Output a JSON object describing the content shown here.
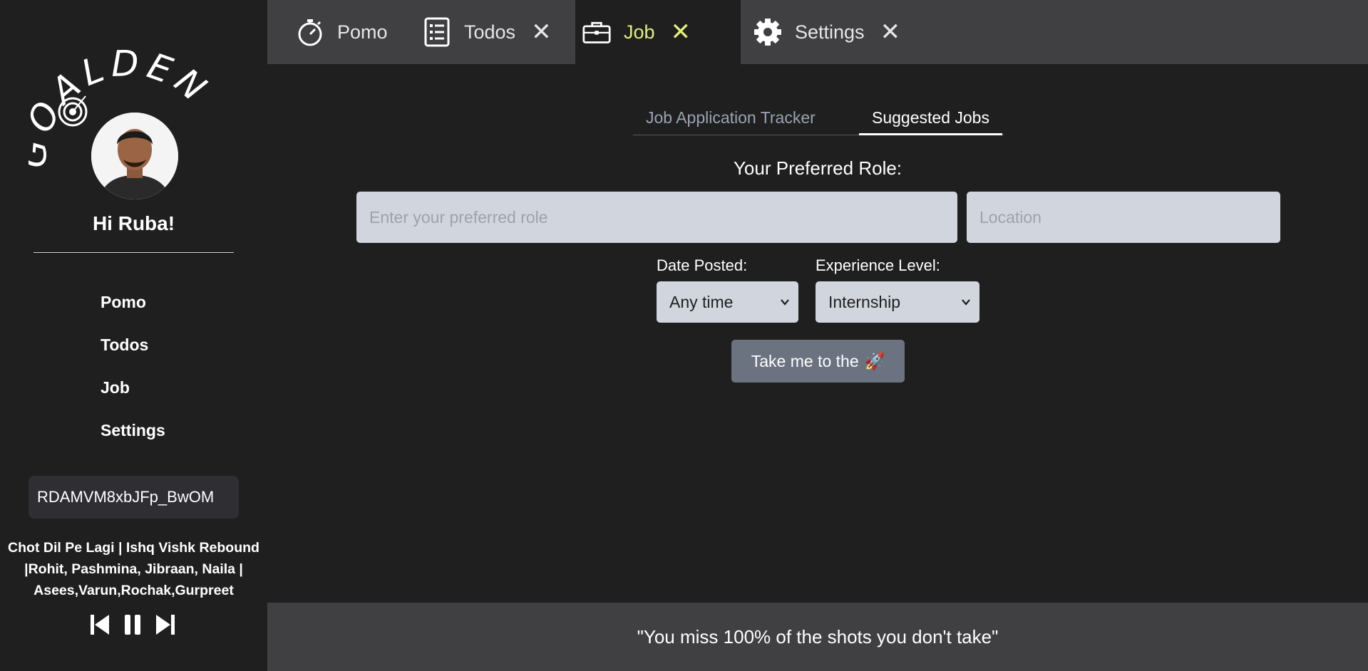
{
  "sidebar": {
    "logo_text": "GOALDEN",
    "greeting": "Hi Ruba!",
    "nav": [
      {
        "label": "Pomo"
      },
      {
        "label": "Todos"
      },
      {
        "label": "Job"
      },
      {
        "label": "Settings"
      }
    ],
    "video_id": "RDAMVM8xbJFp_BwOM",
    "song_title": "Chot Dil Pe Lagi | Ishq Vishk Rebound |Rohit, Pashmina, Jibraan, Naila | Asees,Varun,Rochak,Gurpreet"
  },
  "tabs": [
    {
      "label": "Pomo",
      "icon": "stopwatch-icon",
      "closable": false,
      "active": false
    },
    {
      "label": "Todos",
      "icon": "checklist-icon",
      "closable": true,
      "active": false
    },
    {
      "label": "Job",
      "icon": "briefcase-icon",
      "closable": true,
      "active": true
    },
    {
      "label": "Settings",
      "icon": "gear-icon",
      "closable": true,
      "active": false
    }
  ],
  "close_glyph": "✕",
  "main": {
    "subtabs": [
      {
        "label": "Job Application Tracker",
        "active": false
      },
      {
        "label": "Suggested Jobs",
        "active": true
      }
    ],
    "preferred_role_label": "Your Preferred Role:",
    "role_placeholder": "Enter your preferred role",
    "location_placeholder": "Location",
    "date_posted_label": "Date Posted:",
    "date_posted_value": "Any time",
    "experience_label": "Experience Level:",
    "experience_value": "Internship",
    "go_button_label": "Take me to the",
    "go_button_emoji": "🚀"
  },
  "footer": {
    "quote": "\"You miss 100% of the shots you don't take\""
  },
  "colors": {
    "background": "#1f1f1f",
    "tabbar": "#404043",
    "active_tab_accent": "#e4ee7a",
    "input_bg": "#d1d5de",
    "button_bg": "#6b7280"
  }
}
